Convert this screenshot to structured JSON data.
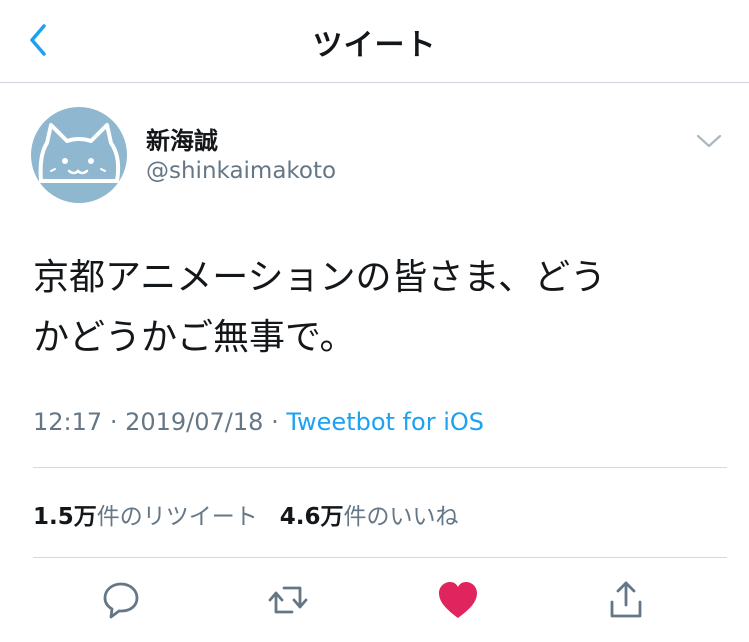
{
  "header": {
    "title": "ツイート"
  },
  "tweet": {
    "author": {
      "display_name": "新海誠",
      "handle": "@shinkaimakoto"
    },
    "text_line1": "京都アニメーションの皆さま、どう",
    "text_line2": "かどうかご無事で。",
    "time": "12:17",
    "date": "2019/07/18",
    "separator": "·",
    "source": "Tweetbot for iOS"
  },
  "stats": {
    "retweets_value": "1.5万",
    "retweets_label": "件のリツイート",
    "likes_value": "4.6万",
    "likes_label": "件のいいね"
  },
  "colors": {
    "accent": "#1da1f2",
    "like": "#e0245e",
    "muted": "#657786",
    "avatar_bg": "#8fb7cf"
  },
  "icons": [
    "back-arrow-icon",
    "chevron-down-icon",
    "reply-icon",
    "retweet-icon",
    "heart-icon",
    "share-icon",
    "cat-avatar-icon"
  ]
}
